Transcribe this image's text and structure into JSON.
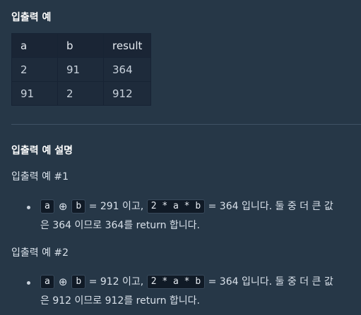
{
  "examples_heading": "입출력 예",
  "table": {
    "headers": [
      "a",
      "b",
      "result"
    ],
    "rows": [
      [
        "2",
        "91",
        "364"
      ],
      [
        "91",
        "2",
        "912"
      ]
    ]
  },
  "explanation_heading": "입출력 예 설명",
  "examples": [
    {
      "title": "입출력 예 #1",
      "code_a": "a",
      "operator": "⊕",
      "code_b": "b",
      "text_1": "= 291 이고,",
      "code_expr": "2 * a * b",
      "text_2": "= 364 입니다. 둘 중 더 큰 값",
      "text_3": "은 364 이므로 364를 return 합니다."
    },
    {
      "title": "입출력 예 #2",
      "code_a": "a",
      "operator": "⊕",
      "code_b": "b",
      "text_1": "= 912 이고,",
      "code_expr": "2 * a * b",
      "text_2": "= 364 입니다. 둘 중 더 큰 값",
      "text_3": "은 912 이므로 912를 return 합니다."
    }
  ]
}
